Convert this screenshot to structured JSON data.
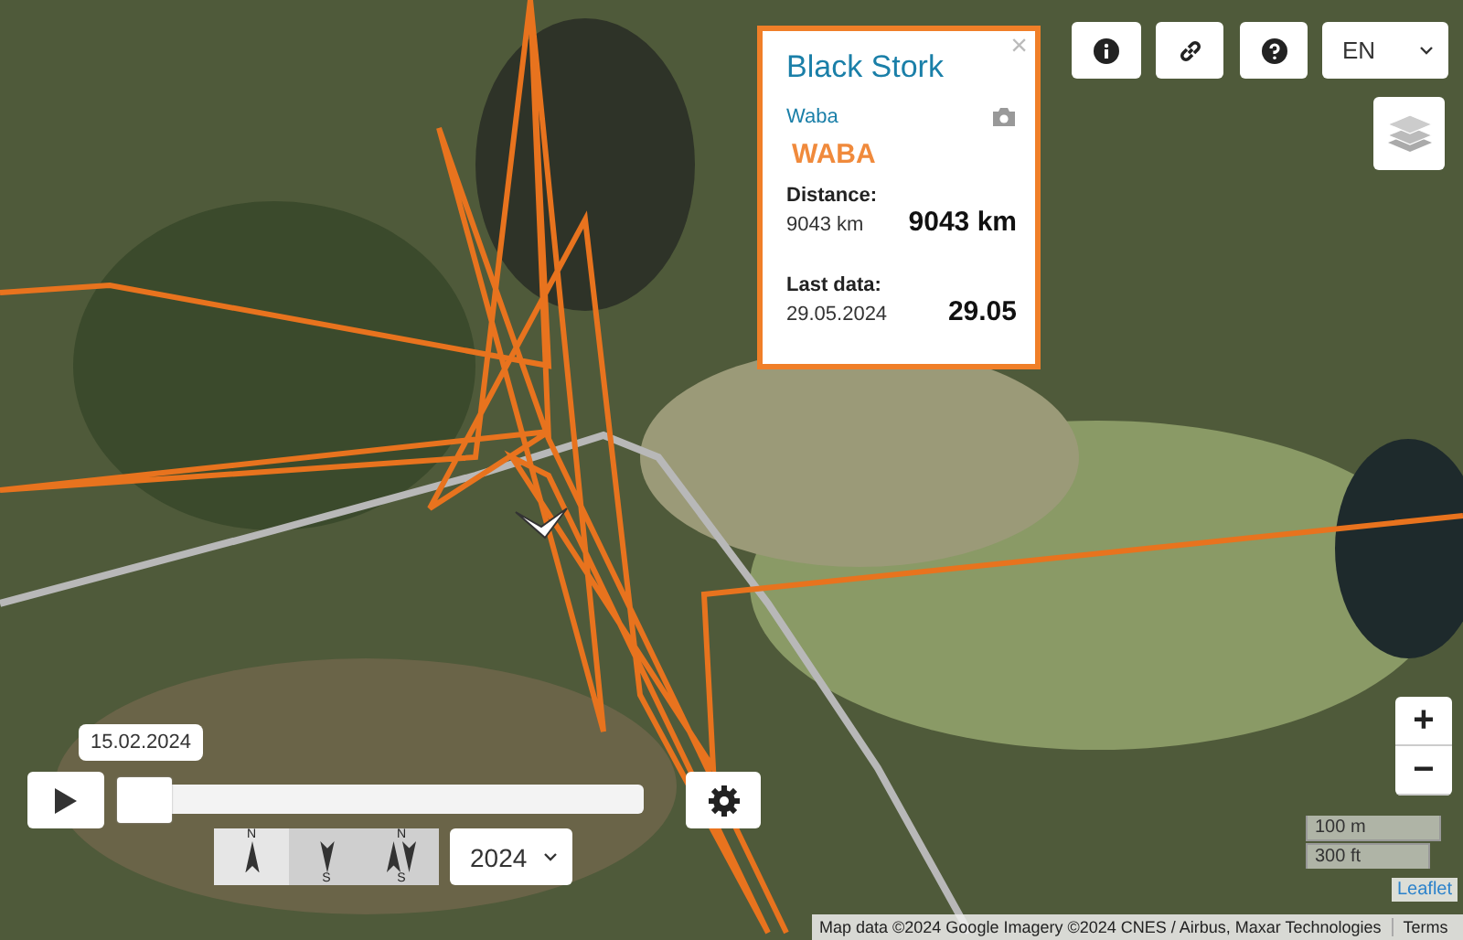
{
  "popup": {
    "title": "Black Stork",
    "close": "×",
    "subtitle": "Waba",
    "name": "WABA",
    "distance_label": "Distance:",
    "distance_small": "9043 km",
    "distance_big": "9043 km",
    "last_label": "Last data:",
    "last_small": "29.05.2024",
    "last_big": "29.05"
  },
  "language": "EN",
  "timeline": {
    "date": "15.02.2024",
    "level": 0
  },
  "direction_buttons": [
    {
      "kind": "north",
      "selected": true,
      "top": "N"
    },
    {
      "kind": "south",
      "selected": false,
      "bottom": "S"
    },
    {
      "kind": "both",
      "selected": false,
      "top": "N",
      "bottom": "S"
    }
  ],
  "year": "2024",
  "zoom": {
    "plus": "+",
    "minus": "−"
  },
  "scale": [
    "100 m",
    "300 ft"
  ],
  "attribution": {
    "leaflet": "Leaflet",
    "text": "Map data ©2024 Google Imagery ©2024 CNES / Airbus, Maxar Technologies",
    "terms": "Terms"
  }
}
